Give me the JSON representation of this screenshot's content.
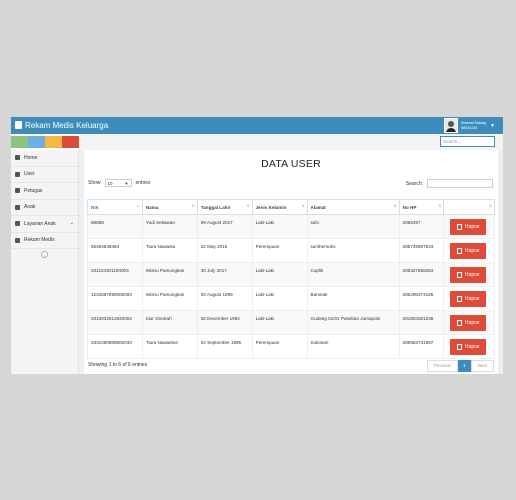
{
  "app": {
    "title": "Rekam Medis Keluarga"
  },
  "user_panel": {
    "line1": "Selamat Datang",
    "line2": "M5115140"
  },
  "colors": {
    "brand": "#3c8dbc",
    "swatches": [
      "#8bc37f",
      "#6ab0e4",
      "#f4b942",
      "#dd4b39"
    ],
    "danger": "#dd4b39"
  },
  "search": {
    "placeholder": "Search..."
  },
  "sidebar": {
    "items": [
      {
        "label": "Home",
        "icon": "home-icon"
      },
      {
        "label": "User",
        "icon": "users-icon"
      },
      {
        "label": "Petugas",
        "icon": "user-icon"
      },
      {
        "label": "Anak",
        "icon": "child-icon"
      },
      {
        "label": "Layanan Anak",
        "icon": "medkit-icon"
      },
      {
        "label": "Rekam Medis",
        "icon": "book-icon"
      }
    ],
    "collapse_glyph": "‹"
  },
  "main": {
    "heading": "DATA USER",
    "show_label": "Show",
    "page_size": "10",
    "entries_label": "entries",
    "search_label": "Search:",
    "columns": [
      "NIK",
      "Nama",
      "Tanggal Lahir",
      "Jenis Kelamin",
      "Alamat",
      "No HP",
      ""
    ],
    "rows": [
      {
        "nik": "88888",
        "nama": "Yudi Setiawan",
        "tgl": "09 August 2017",
        "jk": "Laki-Laki",
        "alamat": "solo",
        "hp": "0856497"
      },
      {
        "nik": "85484848484",
        "nama": "Tiara Nawastu",
        "tgl": "22 May 2015",
        "jk": "Perempuan",
        "alamat": "sumbersuko",
        "hp": "085749687543"
      },
      {
        "nik": "331104301194003",
        "nama": "Wisnu Pamungkas",
        "tgl": "30 July 2017",
        "jk": "Laki-Laki",
        "alamat": "Cuplik",
        "hp": "085327556253"
      },
      {
        "nik": "1234567890000000",
        "nama": "Wisnu Pamungkas",
        "tgl": "03 August 1989",
        "jk": "Laki-Laki",
        "alamat": "Banmati",
        "hp": "085296374185"
      },
      {
        "nik": "3313032612840002",
        "nama": "Idur Onotrah",
        "tgl": "26 December 1984",
        "jk": "Laki-Laki",
        "alamat": "Gudang 01/01 Paseban Jumapolo",
        "hp": "081804361038"
      },
      {
        "nik": "3331080909600030",
        "nama": "Tiara Nawastoe",
        "tgl": "04 September 1996",
        "jk": "Perempuan",
        "alamat": "Sukosari",
        "hp": "085963741987"
      }
    ],
    "delete_label": "Hapus",
    "info": "Showing 1 to 6 of 6 entries",
    "pagination": {
      "previous": "Previous",
      "current": "1",
      "next": "Next"
    }
  }
}
